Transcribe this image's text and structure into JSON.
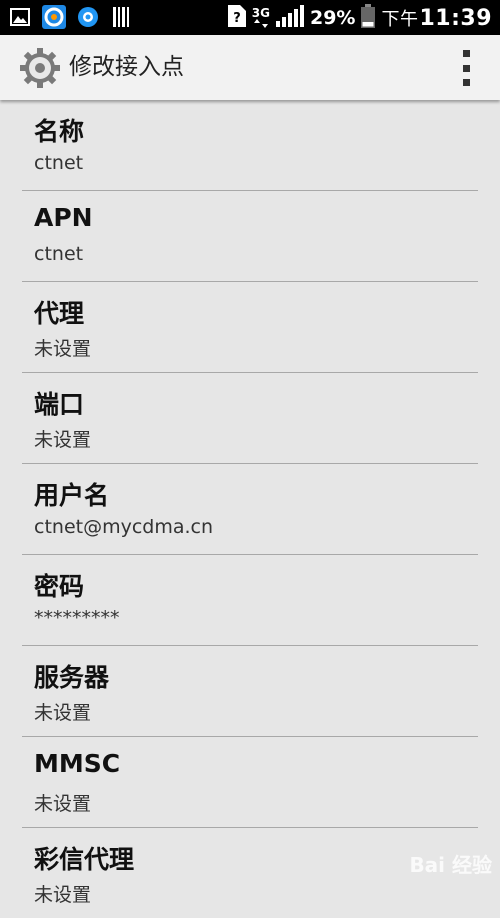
{
  "status_bar": {
    "icons_left": [
      "image-icon",
      "browser-app-icon",
      "qq-app-icon",
      "barcode-icon"
    ],
    "network_type": "3G",
    "battery_percent": "29%",
    "time_prefix": "下午",
    "time": "11:39"
  },
  "action_bar": {
    "title": "修改接入点",
    "icon": "settings-gear-icon",
    "menu_icon": "overflow-menu-icon"
  },
  "preferences": [
    {
      "title": "名称",
      "summary": "ctnet"
    },
    {
      "title": "APN",
      "summary": "ctnet"
    },
    {
      "title": "代理",
      "summary": "未设置"
    },
    {
      "title": "端口",
      "summary": "未设置"
    },
    {
      "title": "用户名",
      "summary": "ctnet@mycdma.cn"
    },
    {
      "title": "密码",
      "summary": "*********"
    },
    {
      "title": "服务器",
      "summary": "未设置"
    },
    {
      "title": "MMSC",
      "summary": "未设置"
    },
    {
      "title": "彩信代理",
      "summary": "未设置"
    }
  ],
  "watermark": "Bai 经验"
}
